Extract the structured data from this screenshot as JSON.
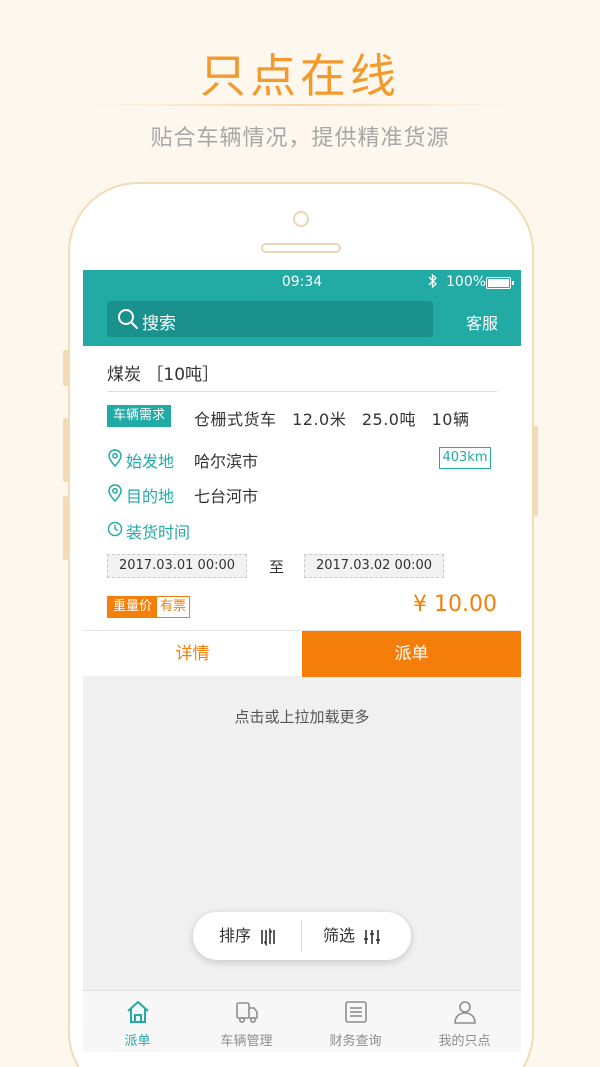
{
  "promo": {
    "title": "只点在线",
    "subtitle": "贴合车辆情况，提供精准货源"
  },
  "status_bar": {
    "time": "09:34",
    "bluetooth_icon": "bluetooth-icon",
    "battery": "100%"
  },
  "nav": {
    "search_label": "搜索",
    "service_label": "客服"
  },
  "card": {
    "cargo": "煤炭 ［10吨］",
    "requirement_badge": "车辆需求",
    "vehicle_type": "仓栅式货车",
    "vehicle_length": "12.0米",
    "vehicle_weight": "25.0吨",
    "vehicle_count": "10辆",
    "origin_label": "始发地",
    "origin": "哈尔滨市",
    "destination_label": "目的地",
    "destination": "七台河市",
    "distance": "403km",
    "loading_time_label": "装货时间",
    "date_from": "2017.03.01 00:00",
    "date_sep": "至",
    "date_to": "2017.03.02 00:00",
    "price_type": "重量价",
    "invoice": "有票",
    "price": "¥ 10.00",
    "detail_button": "详情",
    "dispatch_button": "派单"
  },
  "load_more": "点击或上拉加载更多",
  "float_bar": {
    "sort_label": "排序",
    "filter_label": "筛选"
  },
  "tabs": [
    {
      "label": "派单",
      "icon": "home-icon",
      "active": true
    },
    {
      "label": "车辆管理",
      "icon": "truck-icon",
      "active": false
    },
    {
      "label": "财务查询",
      "icon": "list-icon",
      "active": false
    },
    {
      "label": "我的只点",
      "icon": "user-icon",
      "active": false
    }
  ],
  "colors": {
    "teal": "#22aaa5",
    "orange": "#f47f0b",
    "promo_orange": "#f39a2a",
    "background": "#fdf7ee"
  }
}
